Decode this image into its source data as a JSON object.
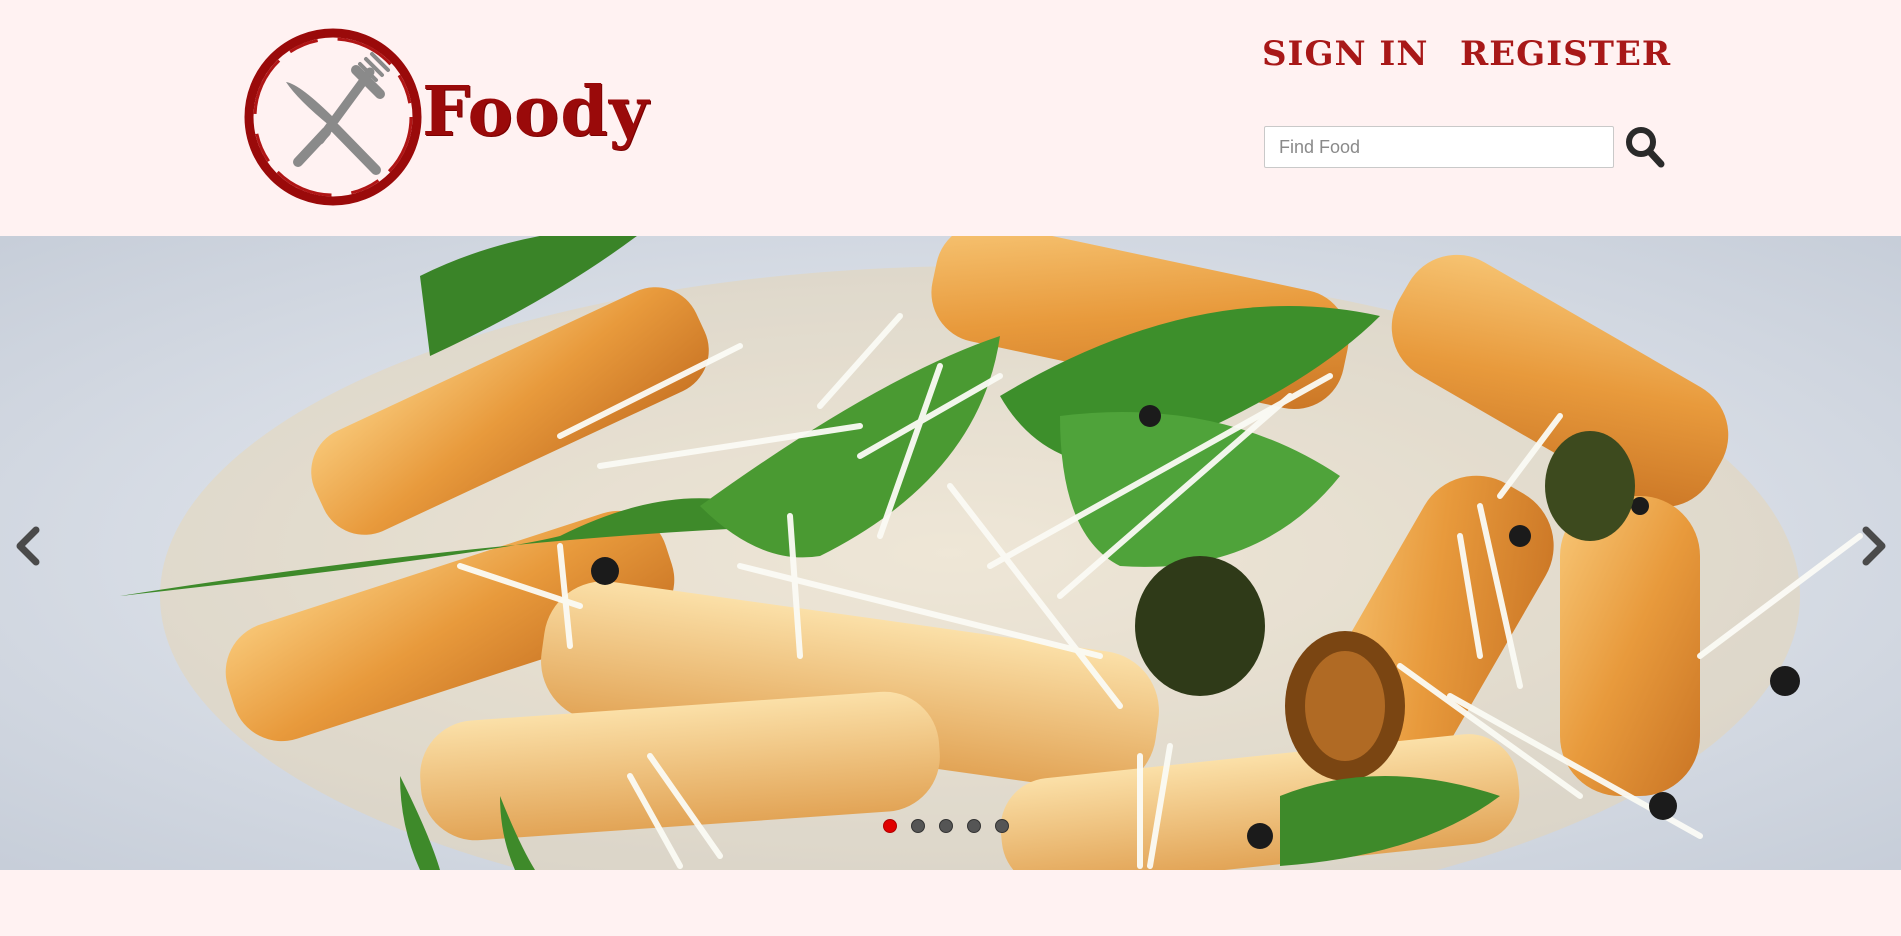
{
  "brand": {
    "name": "Foody"
  },
  "nav": {
    "sign_in": "SIGN IN",
    "register": "REGISTER"
  },
  "search": {
    "placeholder": "Find Food",
    "value": ""
  },
  "icons": {
    "logo": "fork-knife-icon",
    "search": "search-icon",
    "prev": "chevron-left-icon",
    "next": "chevron-right-icon"
  },
  "colors": {
    "brand": "#9a0a0a",
    "nav": "#a81818",
    "background": "#fff2f2",
    "indicator_active": "#e00000",
    "indicator_inactive": "#555555"
  },
  "carousel": {
    "slide_count": 5,
    "active_index": 0,
    "image": "penne pasta with arugula and parmesan"
  }
}
